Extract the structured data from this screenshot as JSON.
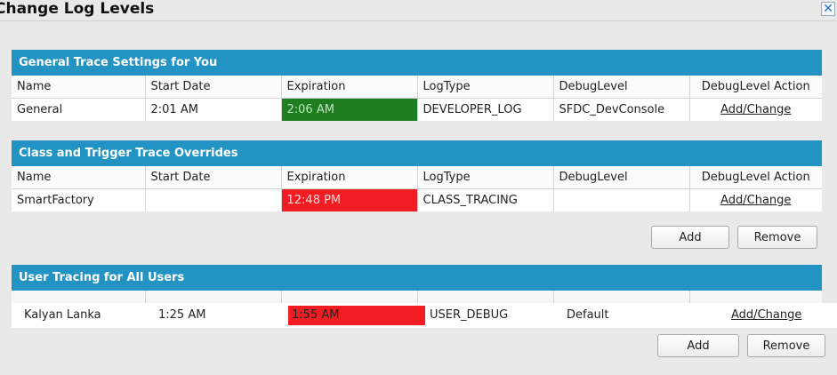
{
  "window": {
    "title": "Change Log Levels",
    "close_icon": "close-icon"
  },
  "columns": [
    "Name",
    "Start Date",
    "Expiration",
    "LogType",
    "DebugLevel",
    "DebugLevel Action"
  ],
  "general": {
    "title": "General Trace Settings for You",
    "row": {
      "name": "General",
      "start": "2:01 AM",
      "expiration": "2:06 AM",
      "logtype": "DEVELOPER_LOG",
      "debuglevel": "SFDC_DevConsole",
      "action": "Add/Change"
    }
  },
  "class_trigger": {
    "title": "Class and Trigger Trace Overrides",
    "row": {
      "name": "SmartFactory",
      "start": "",
      "expiration": "12:48 PM",
      "logtype": "CLASS_TRACING",
      "debuglevel": "",
      "action": "Add/Change"
    },
    "add_label": "Add",
    "remove_label": "Remove"
  },
  "user_tracing": {
    "title": "User Tracing for All Users",
    "row": {
      "name": "Kalyan Lanka",
      "start": "1:25 AM",
      "expiration": "1:55 AM",
      "logtype": "USER_DEBUG",
      "debuglevel": "Default",
      "action": "Add/Change"
    },
    "add_label": "Add",
    "remove_label": "Remove"
  },
  "colors": {
    "header_blue": "#2293c3",
    "expired_red": "#f21d23",
    "active_green": "#1e7d1e"
  }
}
